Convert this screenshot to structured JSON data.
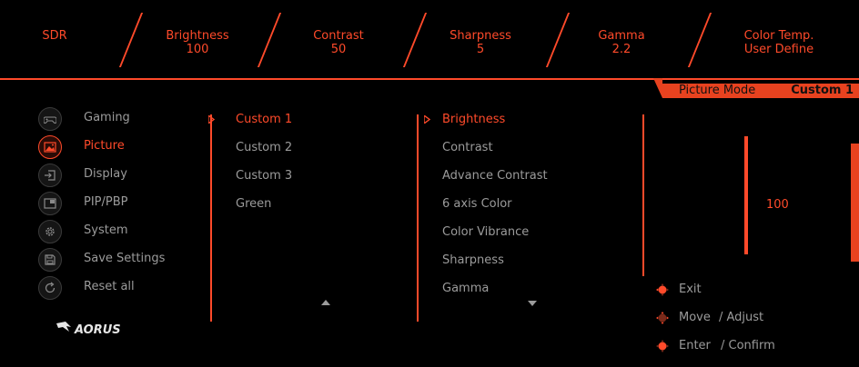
{
  "top_status": {
    "mode": "SDR",
    "brightness_label": "Brightness",
    "brightness_value": "100",
    "contrast_label": "Contrast",
    "contrast_value": "50",
    "sharpness_label": "Sharpness",
    "sharpness_value": "5",
    "gamma_label": "Gamma",
    "gamma_value": "2.2",
    "color_temp_label": "Color Temp.",
    "color_temp_value": "User Define"
  },
  "mode_bar": {
    "label": "Picture Mode",
    "value": "Custom 1"
  },
  "menu": [
    {
      "label": "Gaming",
      "icon": "gamepad-icon",
      "active": false
    },
    {
      "label": "Picture",
      "icon": "picture-icon",
      "active": true
    },
    {
      "label": "Display",
      "icon": "input-icon",
      "active": false
    },
    {
      "label": "PIP/PBP",
      "icon": "pip-icon",
      "active": false
    },
    {
      "label": "System",
      "icon": "gear-icon",
      "active": false
    },
    {
      "label": "Save Settings",
      "icon": "save-icon",
      "active": false
    },
    {
      "label": "Reset all",
      "icon": "reset-icon",
      "active": false
    }
  ],
  "picture_modes": [
    "Custom 1",
    "Custom 2",
    "Custom 3",
    "Green"
  ],
  "picture_settings": [
    "Brightness",
    "Contrast",
    "Advance Contrast",
    "6 axis Color",
    "Color Vibrance",
    "Sharpness",
    "Gamma"
  ],
  "selected_value": {
    "value": "100",
    "level_fraction": 1.0
  },
  "hints": {
    "exit": "Exit",
    "move": "Move",
    "adjust": "/ Adjust",
    "enter": "Enter",
    "confirm": "/ Confirm"
  },
  "brand": "AORUS",
  "colors": {
    "accent": "#ff4a2a",
    "inactive_text": "#9b9b9b",
    "background": "#000000"
  }
}
